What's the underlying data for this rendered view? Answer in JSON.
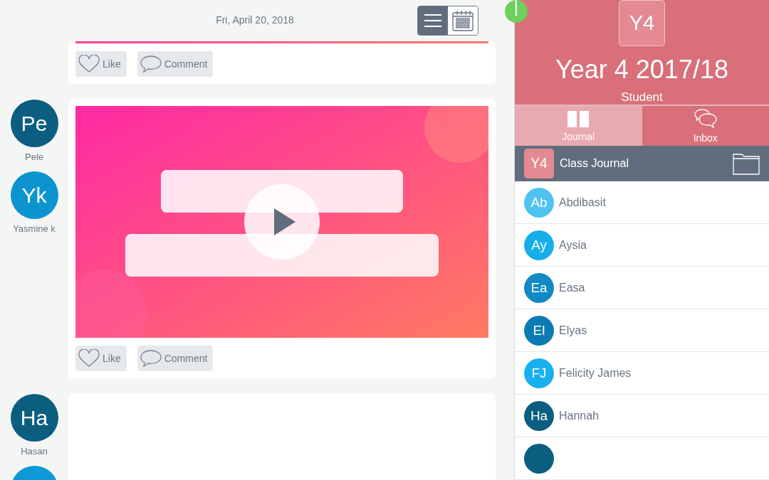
{
  "header": {
    "date": "Fri, April 20, 2018",
    "views": [
      {
        "kind": "list",
        "selected": true
      },
      {
        "kind": "calendar",
        "selected": false
      }
    ]
  },
  "posts": [
    {
      "kind": "line",
      "actions": [
        {
          "kind": "like",
          "label": "Like"
        },
        {
          "kind": "comment",
          "label": "Comment"
        }
      ]
    },
    {
      "avatars": [
        {
          "initials": "Pe",
          "name": "Pele",
          "color": "#0b5e80"
        },
        {
          "initials": "Yk",
          "name": "Yasmine k",
          "color": "#0c94d0"
        }
      ],
      "kind": "video",
      "actions": [
        {
          "kind": "like",
          "label": "Like"
        },
        {
          "kind": "comment",
          "label": "Comment"
        }
      ]
    },
    {
      "avatars": [
        {
          "initials": "Ha",
          "name": "Hasan",
          "color": "#0b5e80"
        },
        {
          "color": "#0e99d6"
        }
      ],
      "kind": "blank"
    }
  ],
  "sidebar": {
    "class": {
      "badge": "Y4",
      "title": "Year 4 2017/18",
      "role": "Student"
    },
    "tabs": [
      {
        "kind": "journal",
        "label": "Journal",
        "selected": true
      },
      {
        "kind": "inbox",
        "label": "Inbox",
        "selected": false
      }
    ],
    "class_journal": {
      "badge": "Y4",
      "label": "Class Journal"
    },
    "members": [
      {
        "initials": "Ab",
        "name": "Abdibasit",
        "color": "#4fc3f0"
      },
      {
        "initials": "Ay",
        "name": "Aysia",
        "color": "#16aeea"
      },
      {
        "initials": "Ea",
        "name": "Easa",
        "color": "#1189c4"
      },
      {
        "initials": "El",
        "name": "Elyas",
        "color": "#0c7bb4"
      },
      {
        "initials": "FJ",
        "name": "Felicity James",
        "color": "#16b0ee"
      },
      {
        "initials": "Ha",
        "name": "Hannah",
        "color": "#0b5e80"
      },
      {
        "color": "#0b5e80"
      }
    ]
  }
}
